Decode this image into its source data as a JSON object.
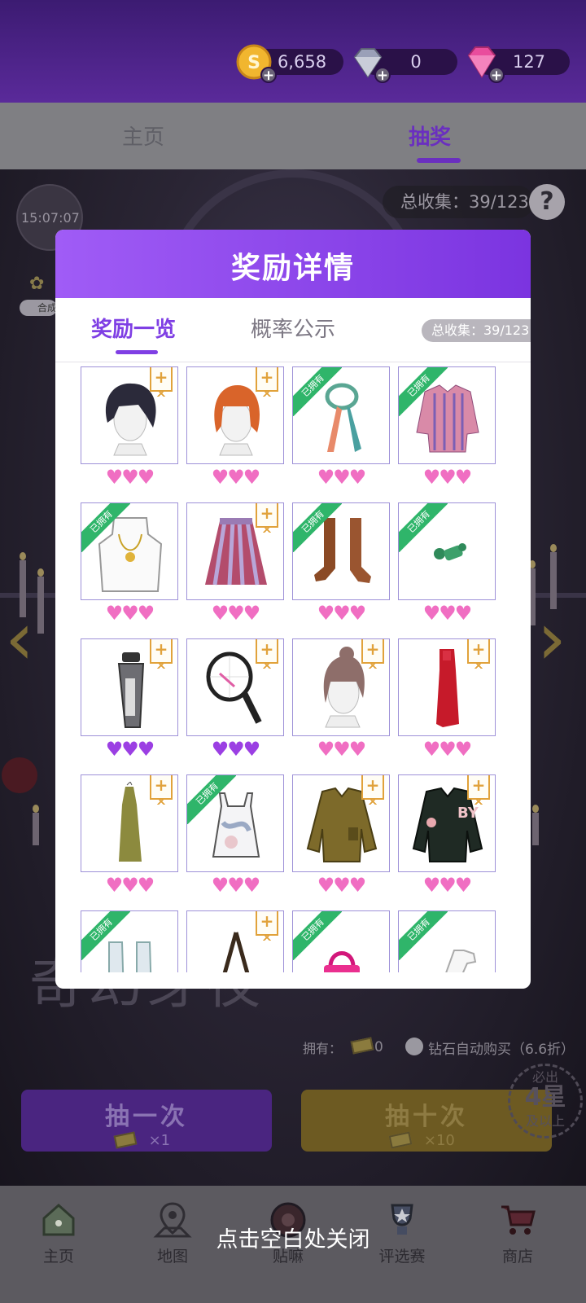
{
  "header": {
    "currencies": [
      {
        "name": "gold-coin",
        "value": "6,658",
        "color": "#f1b62f"
      },
      {
        "name": "diamond",
        "value": "0",
        "color": "#8a8fa5"
      },
      {
        "name": "pink-gem",
        "value": "127",
        "color": "#e94d9d"
      }
    ]
  },
  "tabs": {
    "home": "主页",
    "lottery": "抽奖"
  },
  "scene": {
    "timer": "15:07:07",
    "total_collected": "总收集：39/123",
    "help": "?",
    "side_pill": "合成",
    "title_bg": "奇幻芽夜",
    "own_label": "拥有：",
    "own_count": "0",
    "auto_buy": "钻石自动购买（6.6折）",
    "draw_one": {
      "label": "抽一次",
      "count": "×1"
    },
    "draw_ten": {
      "label": "抽十次",
      "count": "×10"
    },
    "guarantee": {
      "line1": "必出",
      "line2": "4星",
      "line3": "及以上"
    }
  },
  "modal": {
    "title": "奖励详情",
    "tab_rewards": "奖励一览",
    "tab_probability": "概率公示",
    "total_collected": "总收集：39/123",
    "owned_label": "已拥有",
    "plus_label": "+",
    "items": [
      {
        "icon": "short-dark-hair-icon",
        "owned": false,
        "rarity": "pink"
      },
      {
        "icon": "orange-bob-hair-icon",
        "owned": false,
        "rarity": "pink"
      },
      {
        "icon": "silk-scarf-icon",
        "owned": true,
        "rarity": "pink"
      },
      {
        "icon": "striped-blouse-icon",
        "owned": true,
        "rarity": "pink"
      },
      {
        "icon": "pendant-necklace-icon",
        "owned": true,
        "rarity": "pink"
      },
      {
        "icon": "striped-skirt-icon",
        "owned": false,
        "rarity": "pink"
      },
      {
        "icon": "lace-up-boots-icon",
        "owned": true,
        "rarity": "pink"
      },
      {
        "icon": "green-earring-icon",
        "owned": true,
        "rarity": "pink"
      },
      {
        "icon": "water-bottle-icon",
        "owned": false,
        "rarity": "purple"
      },
      {
        "icon": "tennis-racket-icon",
        "owned": false,
        "rarity": "purple"
      },
      {
        "icon": "updo-hair-icon",
        "owned": false,
        "rarity": "pink"
      },
      {
        "icon": "red-dress-icon",
        "owned": false,
        "rarity": "pink"
      },
      {
        "icon": "olive-dress-icon",
        "owned": false,
        "rarity": "pink"
      },
      {
        "icon": "camisole-top-icon",
        "owned": true,
        "rarity": "pink"
      },
      {
        "icon": "olive-jacket-icon",
        "owned": false,
        "rarity": "pink"
      },
      {
        "icon": "varsity-jacket-icon",
        "owned": false,
        "rarity": "pink"
      },
      {
        "icon": "white-boots-icon",
        "owned": true,
        "rarity": "pink"
      },
      {
        "icon": "bag-strap-icon",
        "owned": false,
        "rarity": "pink"
      },
      {
        "icon": "pink-handbag-icon",
        "owned": true,
        "rarity": "pink"
      },
      {
        "icon": "white-glove-icon",
        "owned": true,
        "rarity": "pink"
      }
    ],
    "hearts": "♥♥♥",
    "colors": {
      "pink_heart": "#f06ec2",
      "purple_heart": "#9b3fe3"
    }
  },
  "nav": {
    "items": [
      {
        "label": "主页",
        "icon": "home-icon"
      },
      {
        "label": "地图",
        "icon": "map-pin-icon"
      },
      {
        "label": "贴嘛",
        "icon": "sticker-icon"
      },
      {
        "label": "评选赛",
        "icon": "trophy-icon"
      },
      {
        "label": "商店",
        "icon": "cart-icon"
      }
    ],
    "close_hint": "点击空白处关闭"
  }
}
